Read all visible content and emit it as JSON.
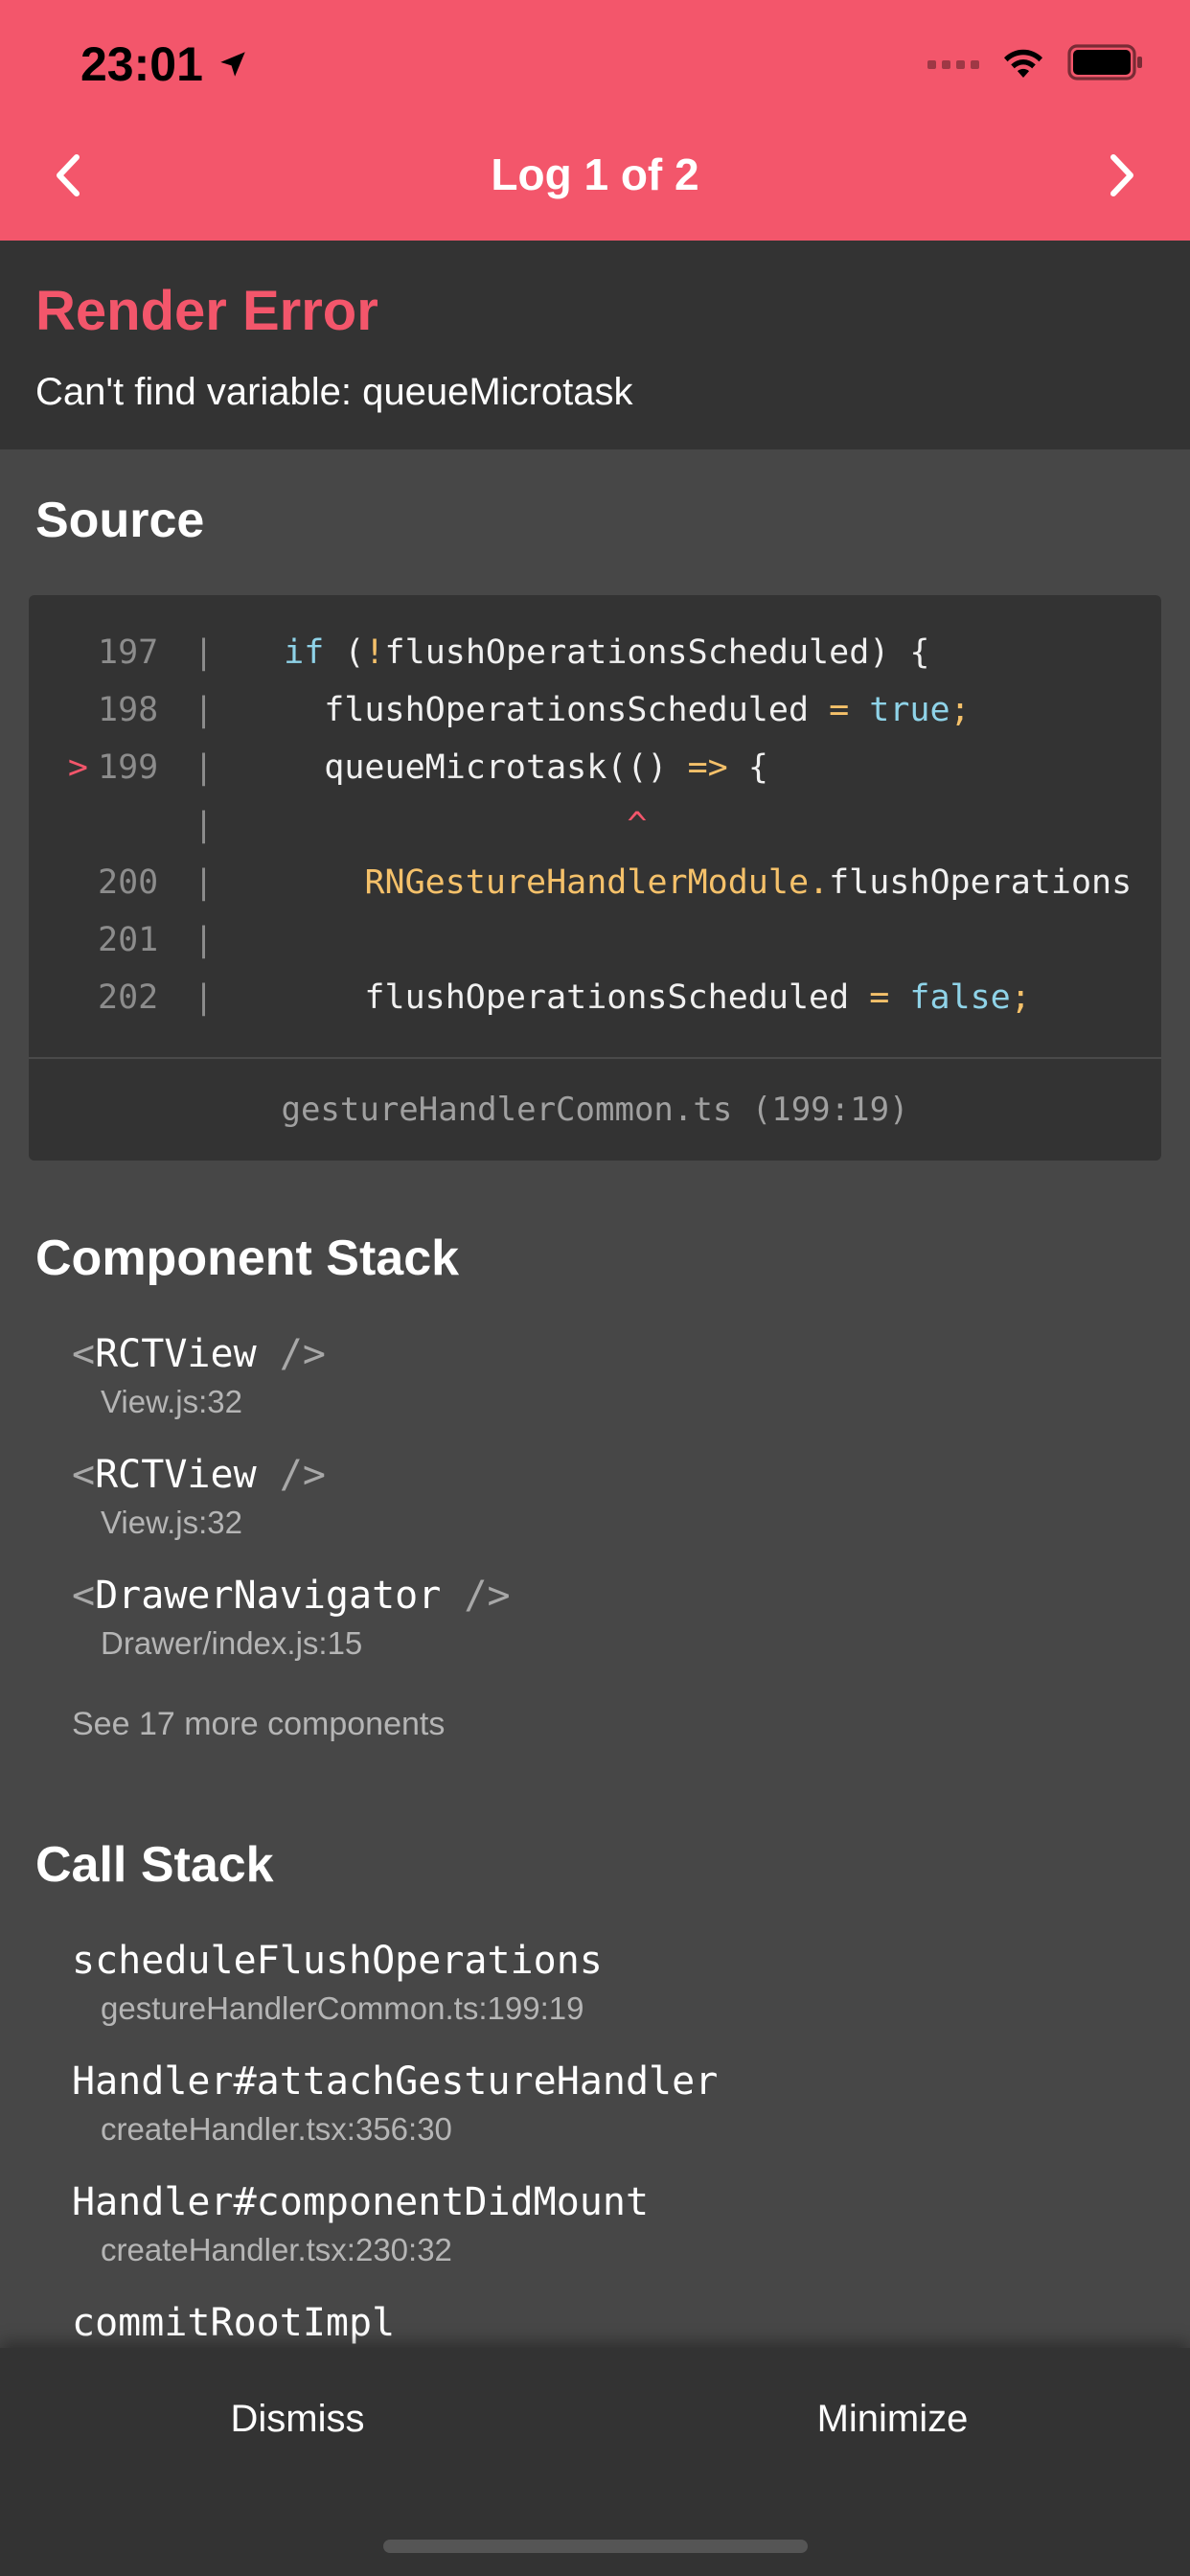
{
  "status_bar": {
    "time": "23:01",
    "location_icon": "location-arrow-icon",
    "wifi_icon": "wifi-icon",
    "battery_icon": "battery-icon"
  },
  "nav": {
    "title": "Log 1 of 2",
    "prev_icon": "chevron-left-icon",
    "next_icon": "chevron-right-icon"
  },
  "colors": {
    "accent": "#f3566b",
    "background": "#474747",
    "panel": "#333333",
    "keyword": "#8fd3e8",
    "operator": "#f5c16a"
  },
  "error": {
    "title": "Render Error",
    "message": "Can't find variable: queueMicrotask"
  },
  "source": {
    "title": "Source",
    "marker": ">",
    "lines": [
      {
        "num": "197",
        "pipe": "|",
        "c1": "  ",
        "c2": "if",
        "c3": " (",
        "c4": "!",
        "c5": "flushOperationsScheduled) {"
      },
      {
        "num": "198",
        "pipe": "|",
        "c1": "    flushOperationsScheduled ",
        "c2": "=",
        "c3": " ",
        "c4": "true",
        "c5": ";"
      },
      {
        "num": "199",
        "pipe": "|",
        "c1": "    queueMicrotask(() ",
        "c2": "=>",
        "c3": " {",
        "c4": "",
        "c5": ""
      },
      {
        "num": "",
        "pipe": "|",
        "c1": "                   ",
        "c2": "^",
        "c3": "",
        "c4": "",
        "c5": ""
      },
      {
        "num": "200",
        "pipe": "|",
        "c1": "      ",
        "c2": "RNGestureHandlerModule.",
        "c3": "flushOperations",
        "c4": "",
        "c5": ""
      },
      {
        "num": "201",
        "pipe": "|",
        "c1": "",
        "c2": "",
        "c3": "",
        "c4": "",
        "c5": ""
      },
      {
        "num": "202",
        "pipe": "|",
        "c1": "      flushOperationsScheduled ",
        "c2": "=",
        "c3": " ",
        "c4": "false",
        "c5": ";"
      }
    ],
    "file": "gestureHandlerCommon.ts (199:19)"
  },
  "component_stack": {
    "title": "Component Stack",
    "items": [
      {
        "open": "<",
        "name": "RCTView",
        "close": " />",
        "loc": "View.js:32"
      },
      {
        "open": "<",
        "name": "RCTView",
        "close": " />",
        "loc": "View.js:32"
      },
      {
        "open": "<",
        "name": "DrawerNavigator",
        "close": " />",
        "loc": "Drawer/index.js:15"
      }
    ],
    "see_more": "See 17 more components"
  },
  "call_stack": {
    "title": "Call Stack",
    "items": [
      {
        "name": "scheduleFlushOperations",
        "loc": "gestureHandlerCommon.ts:199:19"
      },
      {
        "name": "Handler#attachGestureHandler",
        "loc": "createHandler.tsx:356:30"
      },
      {
        "name": "Handler#componentDidMount",
        "loc": "createHandler.tsx:230:32"
      },
      {
        "name": "commitRootImpl",
        "loc": ""
      }
    ]
  },
  "footer": {
    "dismiss": "Dismiss",
    "minimize": "Minimize"
  }
}
